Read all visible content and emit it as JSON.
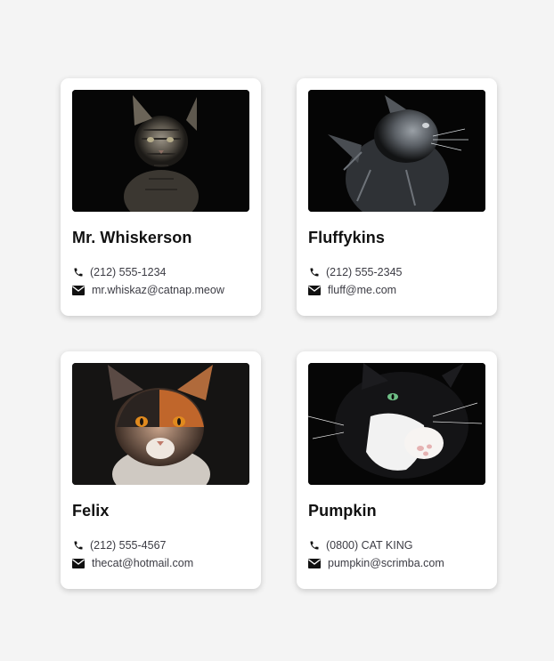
{
  "cards": [
    {
      "name": "Mr. Whiskerson",
      "phone": "(212) 555-1234",
      "email": "mr.whiskaz@catnap.meow",
      "photo": "tabby-cat-photo"
    },
    {
      "name": "Fluffykins",
      "phone": "(212) 555-2345",
      "email": "fluff@me.com",
      "photo": "gray-fluffy-cat-photo"
    },
    {
      "name": "Felix",
      "phone": "(212) 555-4567",
      "email": "thecat@hotmail.com",
      "photo": "calico-cat-photo"
    },
    {
      "name": "Pumpkin",
      "phone": "(0800) CAT KING",
      "email": "pumpkin@scrimba.com",
      "photo": "tuxedo-cat-photo"
    }
  ],
  "icons": {
    "phone": "phone-icon",
    "email": "envelope-icon"
  },
  "colors": {
    "page_bg": "#f4f4f4",
    "card_bg": "#ffffff",
    "name_text": "#111111",
    "contact_text": "#3c3c44"
  }
}
